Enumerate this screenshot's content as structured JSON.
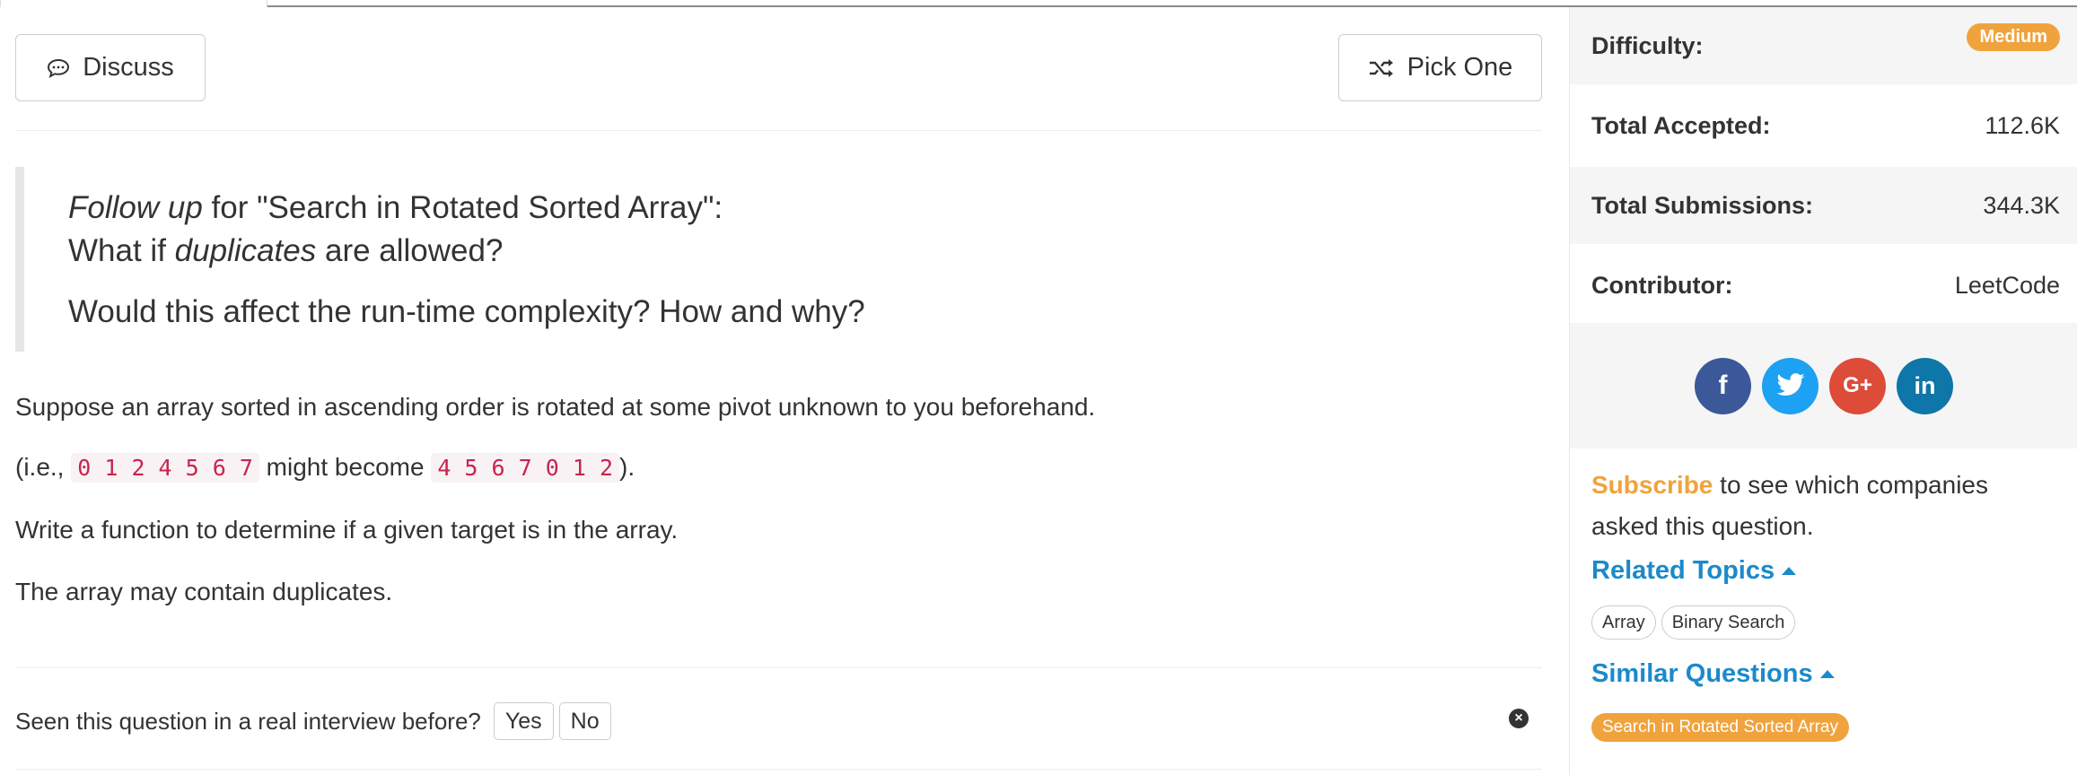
{
  "buttons": {
    "discuss": "Discuss",
    "pick_one": "Pick One"
  },
  "quote": {
    "line1_em": "Follow up",
    "line1_rest": " for \"Search in Rotated Sorted Array\":",
    "line2_pre": "What if ",
    "line2_em": "duplicates",
    "line2_post": " are allowed?",
    "line3": "Would this affect the run-time complexity? How and why?"
  },
  "problem": {
    "p1": "Suppose an array sorted in ascending order is rotated at some pivot unknown to you beforehand.",
    "p2_pre": "(i.e., ",
    "p2_code1": "0 1 2 4 5 6 7",
    "p2_mid": " might become ",
    "p2_code2": "4 5 6 7 0 1 2",
    "p2_post": ").",
    "p3": "Write a function to determine if a given target is in the array.",
    "p4": "The array may contain duplicates."
  },
  "interview": {
    "question": "Seen this question in a real interview before?",
    "yes": "Yes",
    "no": "No"
  },
  "sidebar": {
    "difficulty_label": "Difficulty:",
    "difficulty_value": "Medium",
    "accepted_label": "Total Accepted:",
    "accepted_value": "112.6K",
    "submissions_label": "Total Submissions:",
    "submissions_value": "344.3K",
    "contributor_label": "Contributor:",
    "contributor_value": "LeetCode",
    "social": [
      "facebook-icon",
      "twitter-icon",
      "google-plus-icon",
      "linkedin-icon"
    ],
    "subscribe_link": "Subscribe",
    "subscribe_rest": " to see which companies asked this question.",
    "related_topics_title": "Related Topics",
    "related_topics": [
      "Array",
      "Binary Search"
    ],
    "similar_questions_title": "Similar Questions",
    "similar_questions": [
      "Search in Rotated Sorted Array"
    ]
  },
  "colors": {
    "accent_orange": "#f0a33d",
    "link_blue": "#1a8acb",
    "code_red": "#c7254e"
  }
}
